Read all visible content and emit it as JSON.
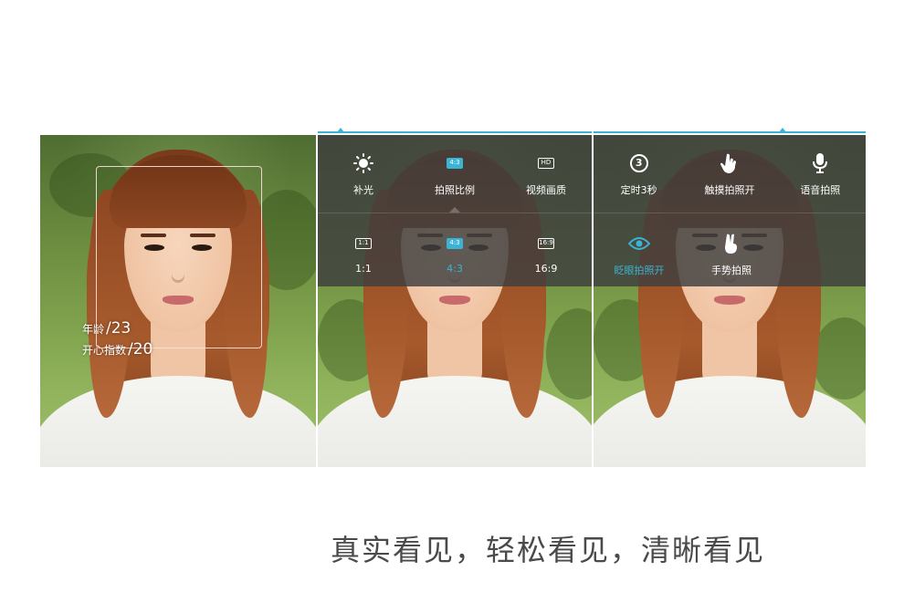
{
  "panels": [
    {
      "id": "face-detect",
      "stats": [
        {
          "label": "年龄",
          "value": "/23"
        },
        {
          "label": "开心指数",
          "value": "/20"
        }
      ]
    },
    {
      "id": "ratio-menu",
      "tabs": [
        {
          "label": "补光",
          "icon": "sun-icon"
        },
        {
          "label": "拍照比例",
          "icon": "aspect-ratio-icon",
          "icon_text": "4:3",
          "active": true
        },
        {
          "label": "视频画质",
          "icon": "video-quality-icon",
          "icon_text": "HD"
        }
      ],
      "options": [
        {
          "label": "1:1",
          "icon_text": "1:1"
        },
        {
          "label": "4:3",
          "icon_text": "4:3",
          "selected": true
        },
        {
          "label": "16:9",
          "icon_text": "16:9"
        }
      ]
    },
    {
      "id": "capture-menu",
      "row1": [
        {
          "label": "定时3秒",
          "icon": "timer-icon",
          "icon_text": "3"
        },
        {
          "label": "触摸拍照开",
          "icon": "touch-hand-icon"
        },
        {
          "label": "语音拍照",
          "icon": "microphone-icon"
        }
      ],
      "row2": [
        {
          "label": "眨眼拍照开",
          "icon": "eye-icon",
          "active": true
        },
        {
          "label": "手势拍照",
          "icon": "victory-hand-icon"
        }
      ]
    }
  ],
  "caption": "真实看见，轻松看见，清晰看见",
  "colors": {
    "accent": "#3bb3d4",
    "menu_bg": "#3e3e3e",
    "caption_text": "#4a4a4a"
  }
}
